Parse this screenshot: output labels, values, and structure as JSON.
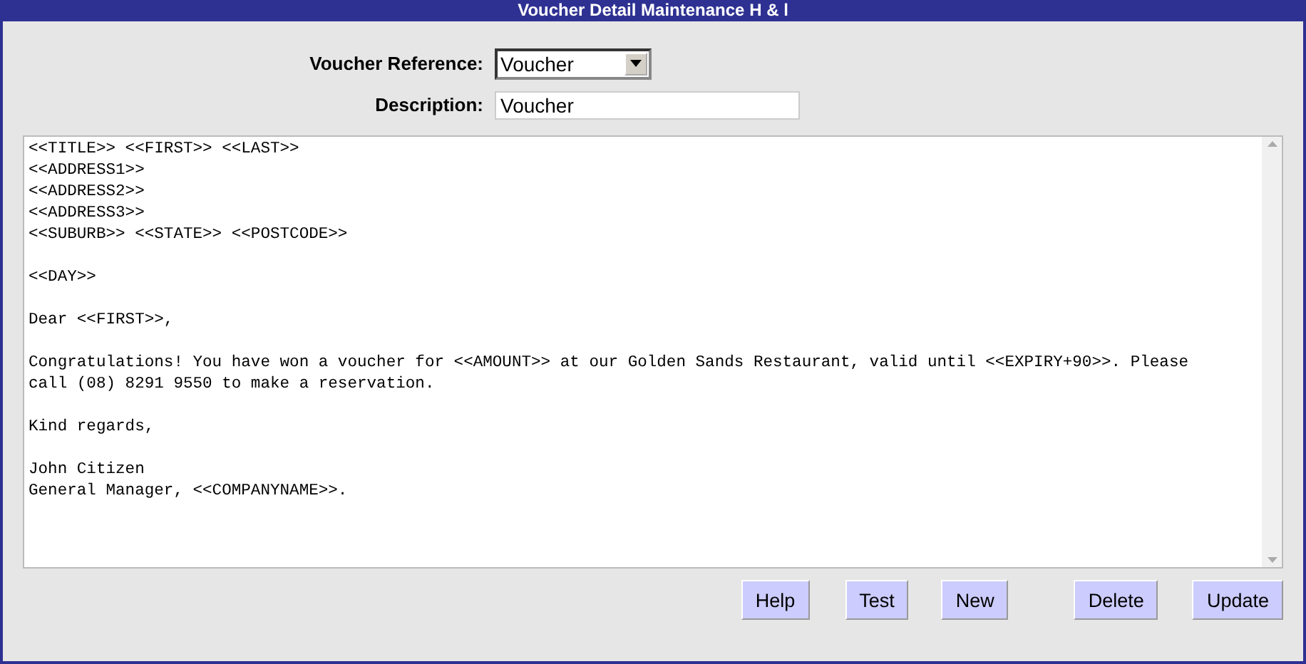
{
  "window": {
    "title": "Voucher Detail Maintenance H & l"
  },
  "fields": [
    {
      "kind": "select",
      "label": "Voucher Reference:",
      "value": "Voucher"
    },
    {
      "kind": "text",
      "label": "Description:",
      "value": "Voucher"
    }
  ],
  "message": "<<TITLE>> <<FIRST>> <<LAST>>\n<<ADDRESS1>>\n<<ADDRESS2>>\n<<ADDRESS3>>\n<<SUBURB>> <<STATE>> <<POSTCODE>>\n\n<<DAY>>\n\nDear <<FIRST>>,\n\nCongratulations! You have won a voucher for <<AMOUNT>> at our Golden Sands Restaurant, valid until <<EXPIRY+90>>. Please\ncall (08) 8291 9550 to make a reservation.\n\nKind regards,\n\nJohn Citizen\nGeneral Manager, <<COMPANYNAME>>.",
  "buttons": [
    "Help",
    "Test",
    "New",
    "Delete",
    "Update"
  ]
}
